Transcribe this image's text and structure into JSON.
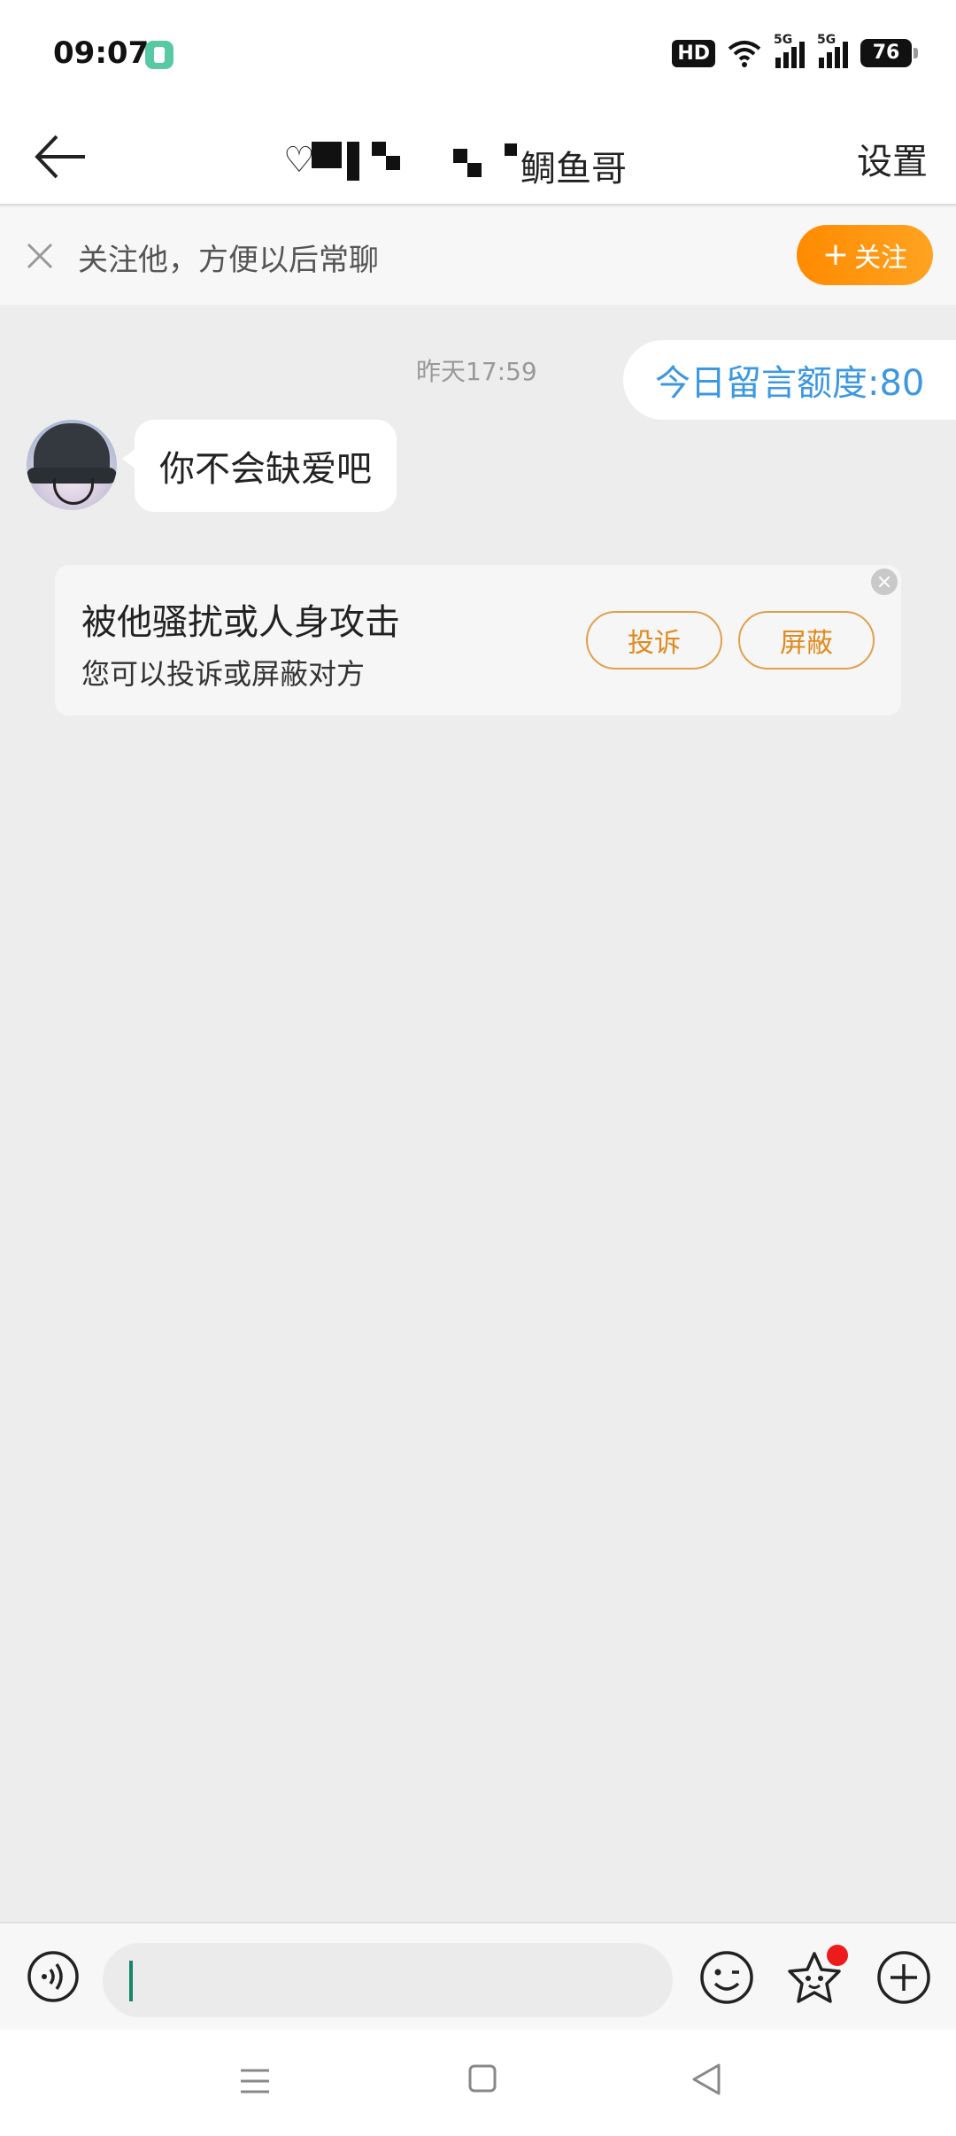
{
  "status_bar": {
    "time": "09:07",
    "hd_label": "HD",
    "network_1": "5G",
    "network_2": "5G",
    "battery": "76",
    "app_icon": "green-app-icon"
  },
  "header": {
    "back_icon": "back-arrow-icon",
    "title_visible_fragment": "鲷鱼哥",
    "title_obscured": true,
    "settings_label": "设置"
  },
  "follow_bar": {
    "close_icon": "close-icon",
    "text": "关注他，方便以后常聊",
    "follow_button_label": "关注",
    "follow_button_color": "#ff8a00"
  },
  "chat": {
    "timestamp": "昨天17:59",
    "quota_text": "今日留言额度:80",
    "quota_color": "#3d98e0",
    "messages": [
      {
        "sender": "other",
        "avatar": "avatar-bucket-hat",
        "text": "你不会缺爱吧"
      }
    ]
  },
  "report_card": {
    "title": "被他骚扰或人身攻击",
    "subtitle": "您可以投诉或屏蔽对方",
    "report_button": "投诉",
    "block_button": "屏蔽",
    "accent_color": "#e08a1e",
    "close_icon": "close-circle-icon"
  },
  "input_bar": {
    "voice_icon": "voice-icon",
    "input_value": "",
    "emoji_icon": "emoji-icon",
    "sticker_icon": "sticker-icon",
    "plus_icon": "plus-circle-icon"
  },
  "nav_bar": {
    "menu_icon": "menu-icon",
    "home_icon": "home-icon",
    "back_icon": "back-triangle-icon"
  }
}
